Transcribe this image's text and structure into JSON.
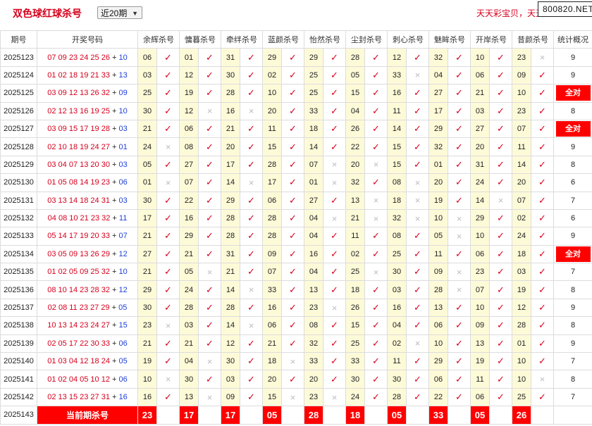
{
  "header": {
    "title": "双色球红球杀号",
    "range_selected": "近20期",
    "slogan": "天天彩宝贝，天天",
    "watermark": "800820.NET"
  },
  "columns": {
    "period": "期号",
    "draw": "开奖号码",
    "experts": [
      "余辉杀号",
      "慵暮杀号",
      "牵绊杀号",
      "蓝颜杀号",
      "怡然杀号",
      "尘封杀号",
      "刺心杀号",
      "魅眸杀号",
      "开岸杀号",
      "昔颜杀号"
    ],
    "stats": "统计概况"
  },
  "all_correct_label": "全对",
  "icons": {
    "correct": "✓",
    "wrong": "×"
  },
  "rows": [
    {
      "period": "2025123",
      "reds": "07 09 23 24 25 26",
      "blue": "10",
      "kills": [
        [
          "06",
          true
        ],
        [
          "01",
          true
        ],
        [
          "31",
          true
        ],
        [
          "29",
          true
        ],
        [
          "29",
          true
        ],
        [
          "28",
          true
        ],
        [
          "12",
          true
        ],
        [
          "32",
          true
        ],
        [
          "10",
          true
        ],
        [
          "23",
          false
        ]
      ],
      "stat": "9"
    },
    {
      "period": "2025124",
      "reds": "01 02 18 19 21 33",
      "blue": "13",
      "kills": [
        [
          "03",
          true
        ],
        [
          "12",
          true
        ],
        [
          "30",
          true
        ],
        [
          "02",
          true
        ],
        [
          "25",
          true
        ],
        [
          "05",
          true
        ],
        [
          "33",
          false
        ],
        [
          "04",
          true
        ],
        [
          "06",
          true
        ],
        [
          "09",
          true
        ]
      ],
      "stat": "9"
    },
    {
      "period": "2025125",
      "reds": "03 09 12 13 26 32",
      "blue": "09",
      "kills": [
        [
          "25",
          true
        ],
        [
          "19",
          true
        ],
        [
          "28",
          true
        ],
        [
          "10",
          true
        ],
        [
          "25",
          true
        ],
        [
          "15",
          true
        ],
        [
          "16",
          true
        ],
        [
          "27",
          true
        ],
        [
          "21",
          true
        ],
        [
          "10",
          true
        ]
      ],
      "stat": "全对"
    },
    {
      "period": "2025126",
      "reds": "02 12 13 16 19 25",
      "blue": "10",
      "kills": [
        [
          "30",
          true
        ],
        [
          "12",
          false
        ],
        [
          "16",
          false
        ],
        [
          "20",
          true
        ],
        [
          "33",
          true
        ],
        [
          "04",
          true
        ],
        [
          "11",
          true
        ],
        [
          "17",
          true
        ],
        [
          "03",
          true
        ],
        [
          "23",
          true
        ]
      ],
      "stat": "8"
    },
    {
      "period": "2025127",
      "reds": "03 09 15 17 19 28",
      "blue": "03",
      "kills": [
        [
          "21",
          true
        ],
        [
          "06",
          true
        ],
        [
          "21",
          true
        ],
        [
          "11",
          true
        ],
        [
          "18",
          true
        ],
        [
          "26",
          true
        ],
        [
          "14",
          true
        ],
        [
          "29",
          true
        ],
        [
          "27",
          true
        ],
        [
          "07",
          true
        ]
      ],
      "stat": "全对"
    },
    {
      "period": "2025128",
      "reds": "02 10 18 19 24 27",
      "blue": "01",
      "kills": [
        [
          "24",
          false
        ],
        [
          "08",
          true
        ],
        [
          "20",
          true
        ],
        [
          "15",
          true
        ],
        [
          "14",
          true
        ],
        [
          "22",
          true
        ],
        [
          "15",
          true
        ],
        [
          "32",
          true
        ],
        [
          "20",
          true
        ],
        [
          "11",
          true
        ]
      ],
      "stat": "9"
    },
    {
      "period": "2025129",
      "reds": "03 04 07 13 20 30",
      "blue": "03",
      "kills": [
        [
          "05",
          true
        ],
        [
          "27",
          true
        ],
        [
          "17",
          true
        ],
        [
          "28",
          true
        ],
        [
          "07",
          false
        ],
        [
          "20",
          false
        ],
        [
          "15",
          true
        ],
        [
          "01",
          true
        ],
        [
          "31",
          true
        ],
        [
          "14",
          true
        ]
      ],
      "stat": "8"
    },
    {
      "period": "2025130",
      "reds": "01 05 08 14 19 23",
      "blue": "06",
      "kills": [
        [
          "01",
          false
        ],
        [
          "07",
          true
        ],
        [
          "14",
          false
        ],
        [
          "17",
          true
        ],
        [
          "01",
          false
        ],
        [
          "32",
          true
        ],
        [
          "08",
          false
        ],
        [
          "20",
          true
        ],
        [
          "24",
          true
        ],
        [
          "20",
          true
        ]
      ],
      "stat": "6"
    },
    {
      "period": "2025131",
      "reds": "03 13 14 18 24 31",
      "blue": "03",
      "kills": [
        [
          "30",
          true
        ],
        [
          "22",
          true
        ],
        [
          "29",
          true
        ],
        [
          "06",
          true
        ],
        [
          "27",
          true
        ],
        [
          "13",
          false
        ],
        [
          "18",
          false
        ],
        [
          "19",
          true
        ],
        [
          "14",
          false
        ],
        [
          "07",
          true
        ]
      ],
      "stat": "7"
    },
    {
      "period": "2025132",
      "reds": "04 08 10 21 23 32",
      "blue": "11",
      "kills": [
        [
          "17",
          true
        ],
        [
          "16",
          true
        ],
        [
          "28",
          true
        ],
        [
          "28",
          true
        ],
        [
          "04",
          false
        ],
        [
          "21",
          false
        ],
        [
          "32",
          false
        ],
        [
          "10",
          false
        ],
        [
          "29",
          true
        ],
        [
          "02",
          true
        ]
      ],
      "stat": "6"
    },
    {
      "period": "2025133",
      "reds": "05 14 17 19 20 33",
      "blue": "07",
      "kills": [
        [
          "21",
          true
        ],
        [
          "29",
          true
        ],
        [
          "28",
          true
        ],
        [
          "28",
          true
        ],
        [
          "04",
          true
        ],
        [
          "11",
          true
        ],
        [
          "08",
          true
        ],
        [
          "05",
          false
        ],
        [
          "10",
          true
        ],
        [
          "24",
          true
        ]
      ],
      "stat": "9"
    },
    {
      "period": "2025134",
      "reds": "03 05 09 13 26 29",
      "blue": "12",
      "kills": [
        [
          "27",
          true
        ],
        [
          "21",
          true
        ],
        [
          "31",
          true
        ],
        [
          "09",
          true
        ],
        [
          "16",
          true
        ],
        [
          "02",
          true
        ],
        [
          "25",
          true
        ],
        [
          "11",
          true
        ],
        [
          "06",
          true
        ],
        [
          "18",
          true
        ]
      ],
      "stat": "全对"
    },
    {
      "period": "2025135",
      "reds": "01 02 05 09 25 32",
      "blue": "10",
      "kills": [
        [
          "21",
          true
        ],
        [
          "05",
          false
        ],
        [
          "21",
          true
        ],
        [
          "07",
          true
        ],
        [
          "04",
          true
        ],
        [
          "25",
          false
        ],
        [
          "30",
          true
        ],
        [
          "09",
          false
        ],
        [
          "23",
          true
        ],
        [
          "03",
          true
        ]
      ],
      "stat": "7"
    },
    {
      "period": "2025136",
      "reds": "08 10 14 23 28 32",
      "blue": "12",
      "kills": [
        [
          "29",
          true
        ],
        [
          "24",
          true
        ],
        [
          "14",
          false
        ],
        [
          "33",
          true
        ],
        [
          "13",
          true
        ],
        [
          "18",
          true
        ],
        [
          "03",
          true
        ],
        [
          "28",
          false
        ],
        [
          "07",
          true
        ],
        [
          "19",
          true
        ]
      ],
      "stat": "8"
    },
    {
      "period": "2025137",
      "reds": "02 08 11 23 27 29",
      "blue": "05",
      "kills": [
        [
          "30",
          true
        ],
        [
          "28",
          true
        ],
        [
          "28",
          true
        ],
        [
          "16",
          true
        ],
        [
          "23",
          false
        ],
        [
          "26",
          true
        ],
        [
          "16",
          true
        ],
        [
          "13",
          true
        ],
        [
          "10",
          true
        ],
        [
          "12",
          true
        ]
      ],
      "stat": "9"
    },
    {
      "period": "2025138",
      "reds": "10 13 14 23 24 27",
      "blue": "15",
      "kills": [
        [
          "23",
          false
        ],
        [
          "03",
          true
        ],
        [
          "14",
          false
        ],
        [
          "06",
          true
        ],
        [
          "08",
          true
        ],
        [
          "15",
          true
        ],
        [
          "04",
          true
        ],
        [
          "06",
          true
        ],
        [
          "09",
          true
        ],
        [
          "28",
          true
        ]
      ],
      "stat": "8"
    },
    {
      "period": "2025139",
      "reds": "02 05 17 22 30 33",
      "blue": "06",
      "kills": [
        [
          "21",
          true
        ],
        [
          "21",
          true
        ],
        [
          "12",
          true
        ],
        [
          "21",
          true
        ],
        [
          "32",
          true
        ],
        [
          "25",
          true
        ],
        [
          "02",
          false
        ],
        [
          "10",
          true
        ],
        [
          "13",
          true
        ],
        [
          "01",
          true
        ]
      ],
      "stat": "9"
    },
    {
      "period": "2025140",
      "reds": "01 03 04 12 18 24",
      "blue": "05",
      "kills": [
        [
          "19",
          true
        ],
        [
          "04",
          false
        ],
        [
          "30",
          true
        ],
        [
          "18",
          false
        ],
        [
          "33",
          true
        ],
        [
          "33",
          true
        ],
        [
          "11",
          true
        ],
        [
          "29",
          true
        ],
        [
          "19",
          true
        ],
        [
          "10",
          true
        ]
      ],
      "stat": "7"
    },
    {
      "period": "2025141",
      "reds": "01 02 04 05 10 12",
      "blue": "06",
      "kills": [
        [
          "10",
          false
        ],
        [
          "30",
          true
        ],
        [
          "03",
          true
        ],
        [
          "20",
          true
        ],
        [
          "20",
          true
        ],
        [
          "30",
          true
        ],
        [
          "30",
          true
        ],
        [
          "06",
          true
        ],
        [
          "11",
          true
        ],
        [
          "10",
          false
        ]
      ],
      "stat": "8"
    },
    {
      "period": "2025142",
      "reds": "02 13 15 23 27 31",
      "blue": "16",
      "kills": [
        [
          "16",
          true
        ],
        [
          "13",
          false
        ],
        [
          "09",
          true
        ],
        [
          "15",
          false
        ],
        [
          "23",
          false
        ],
        [
          "24",
          true
        ],
        [
          "28",
          true
        ],
        [
          "22",
          true
        ],
        [
          "06",
          true
        ],
        [
          "25",
          true
        ]
      ],
      "stat": "7"
    }
  ],
  "current": {
    "period": "2025143",
    "label": "当前期杀号",
    "kills": [
      "23",
      "17",
      "17",
      "05",
      "28",
      "18",
      "05",
      "33",
      "05",
      "26"
    ]
  }
}
